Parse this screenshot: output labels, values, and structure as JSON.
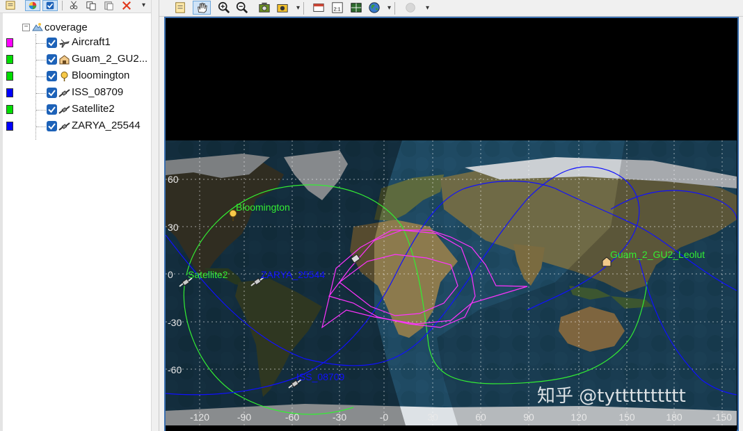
{
  "tree": {
    "root_label": "coverage",
    "items": [
      {
        "label": "Aircraft1",
        "color": "#ff00ff",
        "icon": "aircraft-icon"
      },
      {
        "label": "Guam_2_GU2...",
        "color": "#00dd00",
        "icon": "facility-icon"
      },
      {
        "label": "Bloomington",
        "color": "#00dd00",
        "icon": "place-icon"
      },
      {
        "label": "ISS_08709",
        "color": "#0000ff",
        "icon": "satellite-icon"
      },
      {
        "label": "Satellite2",
        "color": "#00dd00",
        "icon": "satellite-icon"
      },
      {
        "label": "ZARYA_25544",
        "color": "#0000ff",
        "icon": "satellite-icon"
      }
    ]
  },
  "map": {
    "lat_labels": [
      "60",
      "30",
      "0",
      "-30",
      "-60"
    ],
    "lon_labels": [
      "-120",
      "-90",
      "-60",
      "-30",
      "-0",
      "30",
      "60",
      "90",
      "120",
      "150",
      "180",
      "-150"
    ],
    "objects": [
      {
        "name": "Bloomington",
        "color": "#33ee33"
      },
      {
        "name": "Guam_2_GU2_Leolut",
        "color": "#33ee33"
      },
      {
        "name": "Satellite2",
        "color": "#33ee33"
      },
      {
        "name": "ZARYA_25544",
        "color": "#1010ff"
      },
      {
        "name": "ISS_08709",
        "color": "#1010ff"
      }
    ],
    "watermark": "知乎 @tytttttttttt"
  }
}
